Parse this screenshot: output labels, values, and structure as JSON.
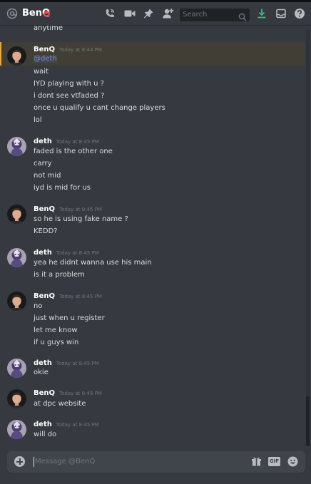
{
  "header": {
    "channel_name": "BenQ",
    "search_placeholder": "Search",
    "icons": [
      "at-icon",
      "phone-call-icon",
      "video-call-icon",
      "pin-icon",
      "add-friend-icon",
      "search-icon",
      "download-icon",
      "inbox-icon",
      "help-icon"
    ]
  },
  "messages": {
    "top_cut_line": "anytime",
    "groups": [
      {
        "author": "BenQ",
        "timestamp": "Today at 8:44 PM",
        "mention": "@deth",
        "lines": [
          "wait",
          "IYD playing with u ?",
          "i dont see vtfaded ?",
          "once u  qualify u cant change players",
          "lol"
        ]
      },
      {
        "author": "deth",
        "timestamp": "Today at 8:45 PM",
        "lines": [
          "faded is the other one",
          "carry",
          "not mid",
          "iyd is mid for us"
        ]
      },
      {
        "author": "BenQ",
        "timestamp": "Today at 8:45 PM",
        "lines": [
          "so he is using fake name ?",
          "KEDD?"
        ]
      },
      {
        "author": "deth",
        "timestamp": "Today at 8:45 PM",
        "lines": [
          "yea he didnt wanna use his main",
          "is it a problem"
        ]
      },
      {
        "author": "BenQ",
        "timestamp": "Today at 8:45 PM",
        "lines": [
          "no",
          "just when u register",
          "let me know",
          "if u guys win"
        ]
      },
      {
        "author": "deth",
        "timestamp": "Today at 8:45 PM",
        "lines": [
          "okie"
        ]
      },
      {
        "author": "BenQ",
        "timestamp": "Today at 8:45 PM",
        "lines": [
          "at dpc website"
        ]
      },
      {
        "author": "deth",
        "timestamp": "Today at 8:45 PM",
        "lines": [
          "will do"
        ]
      }
    ]
  },
  "composer": {
    "placeholder": "Message @BenQ",
    "gif_label": "GIF"
  },
  "colors": {
    "background": "#36393f",
    "composer": "#40444b",
    "mention_highlight": "#413f35",
    "mention_bar": "#faa61a",
    "mention_text": "#7289da",
    "dnd_status": "#f04747",
    "download_icon": "#43b581"
  }
}
